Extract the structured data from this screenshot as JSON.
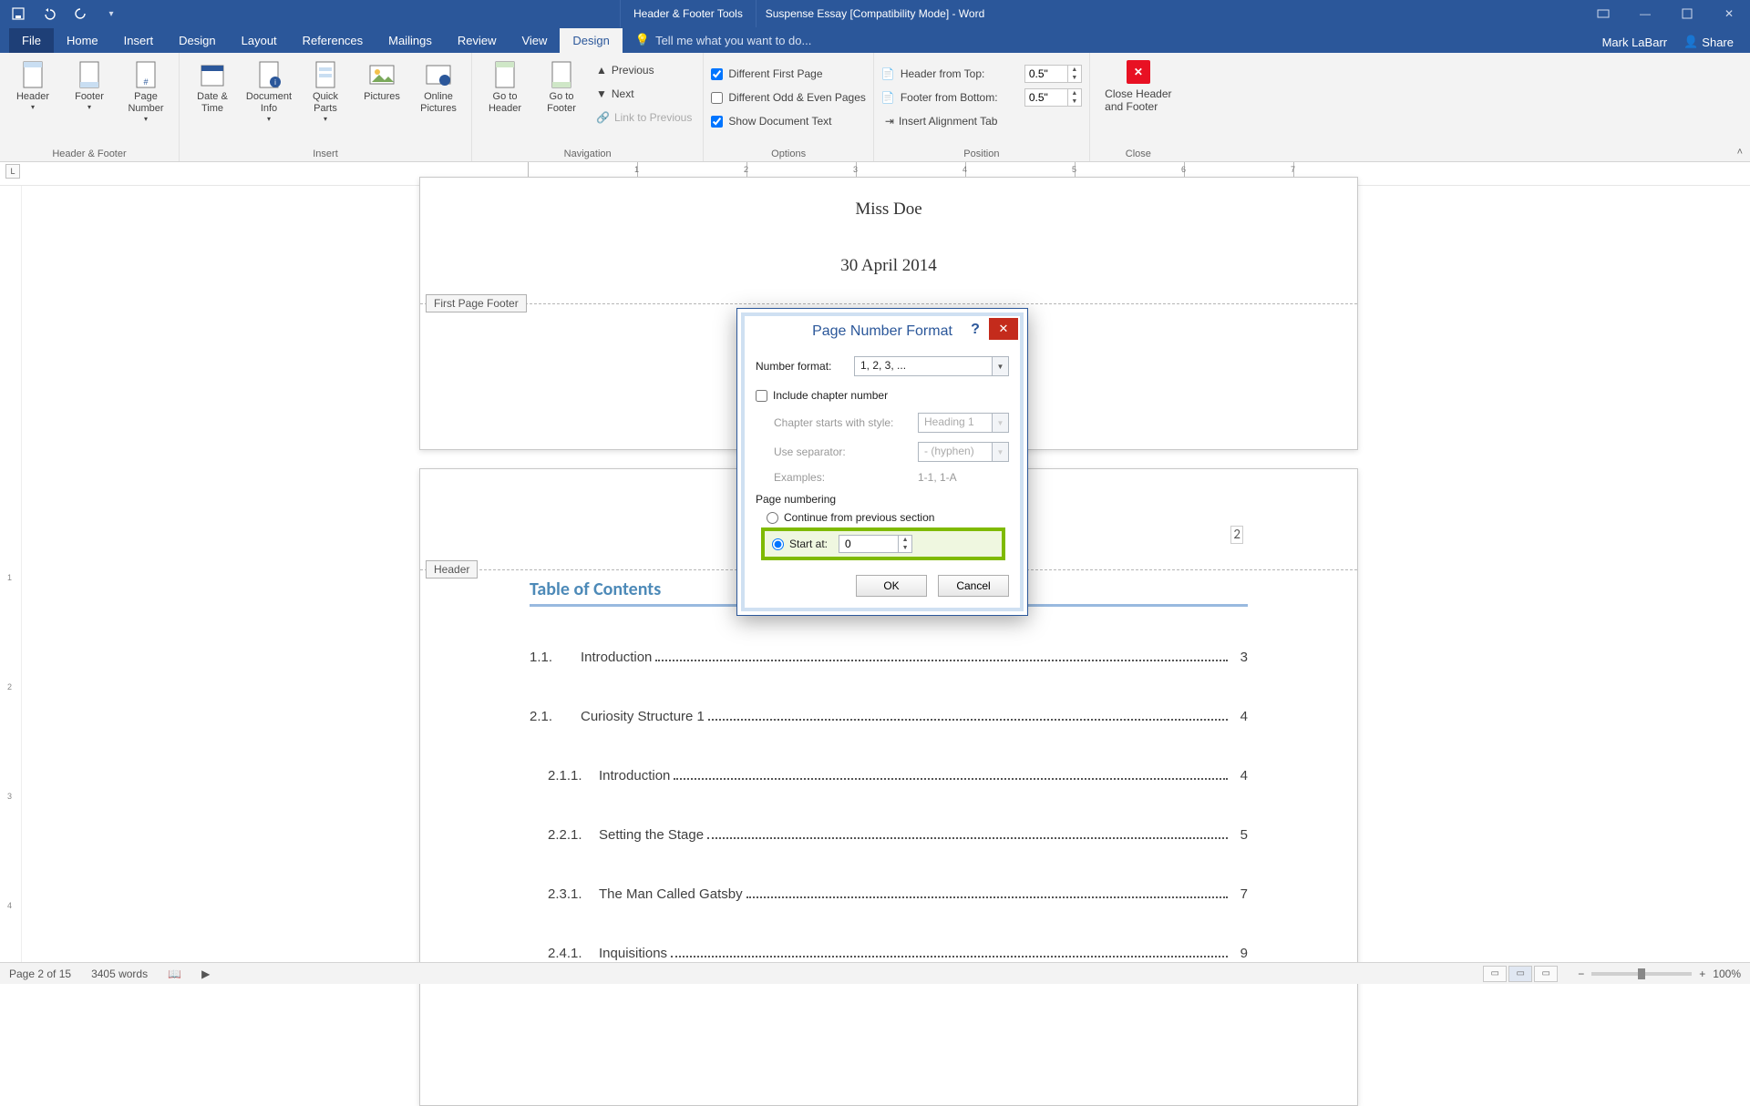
{
  "title": {
    "document": "Suspense Essay [Compatibility Mode] - Word",
    "contextual": "Header & Footer Tools"
  },
  "tabs": {
    "file": "File",
    "home": "Home",
    "insert": "Insert",
    "design_main": "Design",
    "layout": "Layout",
    "references": "References",
    "mailings": "Mailings",
    "review": "Review",
    "view": "View",
    "hf_design": "Design",
    "tellme": "Tell me what you want to do..."
  },
  "user": {
    "name": "Mark LaBarr",
    "share": "Share"
  },
  "ribbon": {
    "groups": {
      "hf": "Header & Footer",
      "insert": "Insert",
      "navigation": "Navigation",
      "options": "Options",
      "position": "Position",
      "close": "Close"
    },
    "hf": {
      "header": "Header",
      "footer": "Footer",
      "page_number": "Page\nNumber"
    },
    "insert": {
      "date_time": "Date &\nTime",
      "doc_info": "Document\nInfo",
      "quick_parts": "Quick\nParts",
      "pictures": "Pictures",
      "online_pictures": "Online\nPictures"
    },
    "nav": {
      "goto_header": "Go to\nHeader",
      "goto_footer": "Go to\nFooter",
      "previous": "Previous",
      "next": "Next",
      "link": "Link to Previous"
    },
    "options": {
      "diff_first": "Different First Page",
      "diff_oe": "Different Odd & Even Pages",
      "show_doc": "Show Document Text"
    },
    "position": {
      "header_from_top": "Header from Top:",
      "footer_from_bottom": "Footer from Bottom:",
      "insert_align": "Insert Alignment Tab",
      "header_val": "0.5\"",
      "footer_val": "0.5\""
    },
    "close": "Close Header\nand Footer"
  },
  "ruler": {
    "indicator": "L",
    "numbers": [
      "1",
      "2",
      "3",
      "4",
      "5",
      "6",
      "7"
    ]
  },
  "document": {
    "header_name": "Miss Doe",
    "header_date": "30 April 2014",
    "first_page_footer_tag": "First Page Footer",
    "header_tag": "Header",
    "page_number_display": "2",
    "toc_title": "Table of Contents",
    "toc": [
      {
        "num": "1.1.",
        "title": "Introduction",
        "page": "3",
        "indent": false
      },
      {
        "num": "2.1.",
        "title": "Curiosity Structure 1",
        "page": "4",
        "indent": false
      },
      {
        "num": "2.1.1.",
        "title": "Introduction",
        "page": "4",
        "indent": true
      },
      {
        "num": "2.2.1.",
        "title": "Setting the Stage",
        "page": "5",
        "indent": true
      },
      {
        "num": "2.3.1.",
        "title": "The Man Called Gatsby",
        "page": "7",
        "indent": true
      },
      {
        "num": "2.4.1.",
        "title": "Inquisitions",
        "page": "9",
        "indent": true
      }
    ]
  },
  "dialog": {
    "title": "Page Number Format",
    "number_format_label": "Number format:",
    "number_format_value": "1, 2, 3, ...",
    "include_chapter": "Include chapter number",
    "chapter_starts_label": "Chapter starts with style:",
    "chapter_starts_value": "Heading 1",
    "separator_label": "Use separator:",
    "separator_value": "-   (hyphen)",
    "examples_label": "Examples:",
    "examples_value": "1-1, 1-A",
    "page_numbering": "Page numbering",
    "continue_label": "Continue from previous section",
    "start_at_label": "Start at:",
    "start_at_value": "0",
    "ok": "OK",
    "cancel": "Cancel"
  },
  "status": {
    "page": "Page 2 of 15",
    "words": "3405 words",
    "zoom": "100%"
  }
}
